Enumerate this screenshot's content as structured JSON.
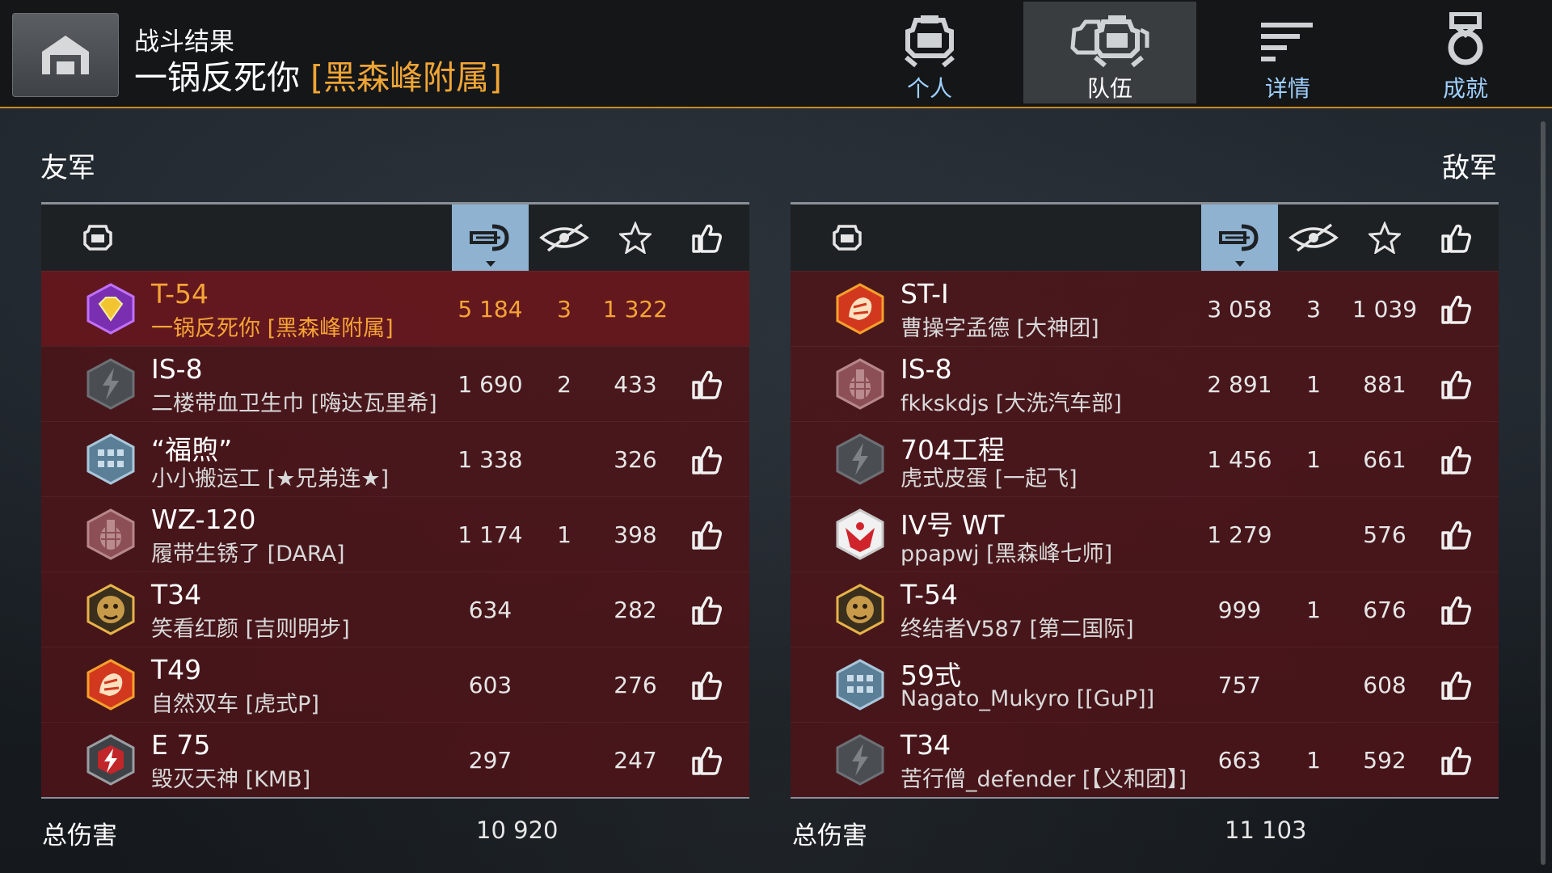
{
  "header": {
    "title_small": "战斗结果",
    "player_name": "一锅反死你",
    "clan": "[黑森峰附属]",
    "tabs": [
      {
        "id": "personal",
        "label": "个人",
        "icon": "single-tank-icon"
      },
      {
        "id": "team",
        "label": "队伍",
        "icon": "team-tanks-icon",
        "active": true
      },
      {
        "id": "details",
        "label": "详情",
        "icon": "details-list-icon"
      },
      {
        "id": "achievements",
        "label": "成就",
        "icon": "medal-icon"
      }
    ]
  },
  "colors": {
    "accent": "#c98a22",
    "highlight": "#f4a436",
    "sorted_header": "#8fb2d1",
    "row_bg": "#4e1418"
  },
  "allies": {
    "title": "友军",
    "rows": [
      {
        "vehicle": "T-54",
        "player": "一锅反死你 [黑森峰附属]",
        "damage": "5 184",
        "kills": "3",
        "assisted": "1 322",
        "like": false,
        "me": true,
        "badge": "diamond-badge-icon"
      },
      {
        "vehicle": "IS-8",
        "player": "二楼带血卫生巾 [嗨达瓦里希]",
        "damage": "1 690",
        "kills": "2",
        "assisted": "433",
        "like": true,
        "badge": "lightning-badge-icon"
      },
      {
        "vehicle": "“福煦”",
        "player": "小小搬运工 [★兄弟连★]",
        "damage": "1 338",
        "kills": "",
        "assisted": "326",
        "like": true,
        "badge": "blue-hex-badge-icon"
      },
      {
        "vehicle": "WZ-120",
        "player": "履带生锈了 [DARA]",
        "damage": "1 174",
        "kills": "1",
        "assisted": "398",
        "like": true,
        "badge": "grenade-badge-icon"
      },
      {
        "vehicle": "T34",
        "player": "笑看红颜 [吉则明步]",
        "damage": "634",
        "kills": "",
        "assisted": "282",
        "like": true,
        "badge": "tiger-badge-icon"
      },
      {
        "vehicle": "T49",
        "player": "自然双车 [虎式P]",
        "damage": "603",
        "kills": "",
        "assisted": "276",
        "like": true,
        "badge": "dragon-badge-icon"
      },
      {
        "vehicle": "E 75",
        "player": "毁灭天神 [KMB]",
        "damage": "297",
        "kills": "",
        "assisted": "247",
        "like": true,
        "badge": "red-lightning-badge-icon"
      }
    ],
    "total_label": "总伤害",
    "total_damage": "10 920"
  },
  "enemies": {
    "title": "敌军",
    "rows": [
      {
        "vehicle": "ST-I",
        "player": "曹操字孟德 [大神团]",
        "damage": "3 058",
        "kills": "3",
        "assisted": "1 039",
        "like": true,
        "badge": "dragon-badge-icon"
      },
      {
        "vehicle": "IS-8",
        "player": "fkkskdjs [大洗汽车部]",
        "damage": "2 891",
        "kills": "1",
        "assisted": "881",
        "like": true,
        "badge": "grenade-badge-icon"
      },
      {
        "vehicle": "704工程",
        "player": "虎式皮蛋 [一起飞]",
        "damage": "1 456",
        "kills": "1",
        "assisted": "661",
        "like": true,
        "badge": "lightning-badge-icon"
      },
      {
        "vehicle": "IV号 WT",
        "player": "ppapwj [黑森峰七师]",
        "damage": "1 279",
        "kills": "",
        "assisted": "576",
        "like": true,
        "badge": "eagle-badge-icon"
      },
      {
        "vehicle": "T-54",
        "player": "终结者V587 [第二国际]",
        "damage": "999",
        "kills": "1",
        "assisted": "676",
        "like": true,
        "badge": "tiger-badge-icon"
      },
      {
        "vehicle": "59式",
        "player": "Nagato_Mukyro [[GuP]]",
        "damage": "757",
        "kills": "",
        "assisted": "608",
        "like": true,
        "badge": "blue-hex-badge-icon"
      },
      {
        "vehicle": "T34",
        "player": "苦行僧_defender [【义和团】]",
        "damage": "663",
        "kills": "1",
        "assisted": "592",
        "like": true,
        "badge": "lightning-badge-icon"
      }
    ],
    "total_label": "总伤害",
    "total_damage": "11 103"
  }
}
